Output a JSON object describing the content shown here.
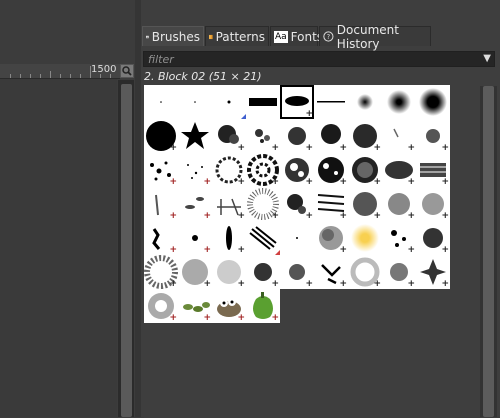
{
  "ruler": {
    "label": "1500"
  },
  "icons": {
    "zoom": "magnifier-icon",
    "brushes_tab": "brush-icon",
    "patterns_tab": "pattern-icon",
    "fonts_tab": "font-icon",
    "history_tab": "history-icon",
    "filter_dropdown": "chevron-down-icon"
  },
  "tabs": [
    {
      "label": "Brushes",
      "active": true
    },
    {
      "label": "Patterns",
      "active": false
    },
    {
      "label": "Fonts",
      "active": false
    },
    {
      "label": "Document History",
      "active": false
    }
  ],
  "fonts_icon_text": "Aa",
  "filter": {
    "placeholder": "filter"
  },
  "selected_brush": "2. Block 02 (51 × 21)"
}
